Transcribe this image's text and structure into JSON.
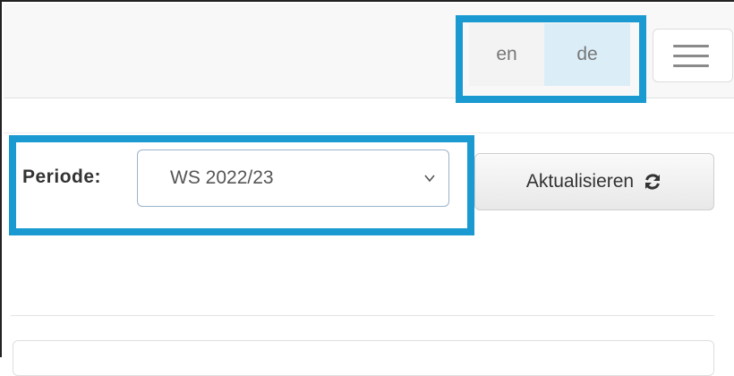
{
  "languages": {
    "en": "en",
    "de": "de",
    "active": "de"
  },
  "filter": {
    "periode_label": "Periode:",
    "periode_value": "WS 2022/23",
    "refresh_label": "Aktualisieren"
  },
  "icons": {
    "menu": "hamburger-menu-icon",
    "dropdown": "chevron-down-icon",
    "refresh": "refresh-icon"
  },
  "colors": {
    "highlight": "#1a9ad1",
    "active_language_bg": "#dbeef8"
  }
}
